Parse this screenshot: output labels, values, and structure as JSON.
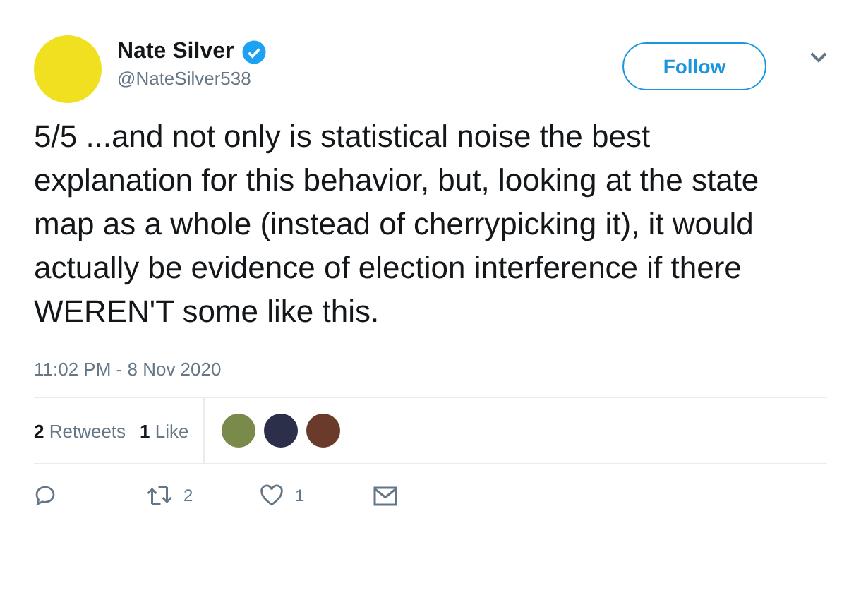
{
  "author": {
    "name": "Nate Silver",
    "verified": true,
    "handle": "@NateSilver538"
  },
  "follow_button": "Follow",
  "tweet_text": "5/5 ...and not only is statistical noise the best explanation for this behavior, but, looking at the state map as a whole (instead of cherrypicking it), it would actually be evidence of election interference if there WEREN'T some like this.",
  "timestamp": "11:02 PM - 8 Nov 2020",
  "stats": [
    "**2** Retweets",
    "**1** Like"
  ],
  "liker_avatars": [
    {
      "color": "#7a8a4a"
    },
    {
      "color": "#2c2f4a"
    },
    {
      "color": "#6a3a2a"
    }
  ],
  "actions": [
    {
      "kind": "reply"
    },
    {
      "kind": "retweet",
      "count": "2"
    },
    {
      "kind": "like",
      "count": "1"
    },
    {
      "kind": "message"
    }
  ]
}
